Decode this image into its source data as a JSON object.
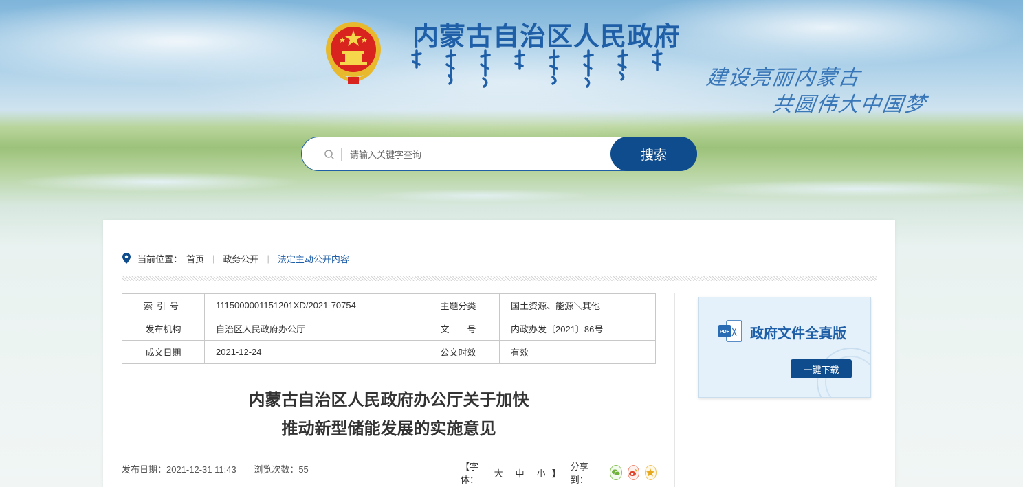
{
  "header": {
    "site_title": "内蒙古自治区人民政府",
    "slogan_line1": "建设亮丽内蒙古",
    "slogan_line2": "共圆伟大中国梦"
  },
  "search": {
    "placeholder": "请输入关键字查询",
    "button_label": "搜索"
  },
  "breadcrumb": {
    "prefix": "当前位置：",
    "items": [
      "首页",
      "政务公开",
      "法定主动公开内容"
    ]
  },
  "meta_table": {
    "rows": [
      {
        "k1": "索引号",
        "v1": "1115000001151201XD/2021-70754",
        "k2": "主题分类",
        "v2": "国土资源、能源＼其他"
      },
      {
        "k1": "发布机构",
        "v1": "自治区人民政府办公厅",
        "k2": "文　　号",
        "v2": "内政办发〔2021〕86号"
      },
      {
        "k1": "成文日期",
        "v1": "2021-12-24",
        "k2": "公文时效",
        "v2": "有效"
      }
    ]
  },
  "document": {
    "title_line1": "内蒙古自治区人民政府办公厅关于加快",
    "title_line2": "推动新型储能发展的实施意见",
    "publish_date": "发布日期：2021-12-31 11:43",
    "view_count": "浏览次数：55"
  },
  "tools": {
    "font_label_open": "【字体：",
    "font_large": "大",
    "font_medium": "中",
    "font_small": "小",
    "font_label_close": "】",
    "share_label": "分享到："
  },
  "pdf_panel": {
    "title": "政府文件全真版",
    "download_label": "一键下载"
  },
  "colors": {
    "brand_blue": "#0e4c8d",
    "title_blue": "#1f5fa8",
    "wechat_green": "#6fb33c",
    "weibo_red": "#e0452c",
    "favorite_yellow": "#e8a81c"
  }
}
